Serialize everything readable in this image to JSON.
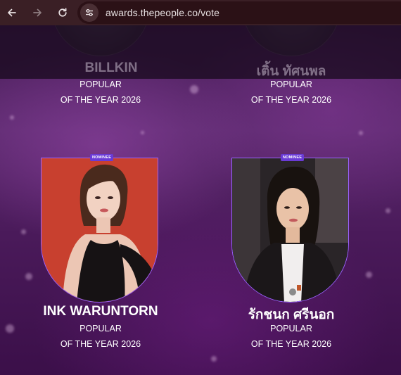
{
  "browser": {
    "url": "awards.thepeople.co/vote",
    "back_icon": "arrow-left-icon",
    "forward_icon": "arrow-right-icon",
    "reload_icon": "reload-icon",
    "site_info_icon": "tune-icon"
  },
  "previous_row": [
    {
      "name": "BILLKIN",
      "caption_line1": "POPULAR",
      "caption_line2": "OF THE YEAR 2026"
    },
    {
      "name": "เติ้น ทัศนพล",
      "caption_line1": "POPULAR",
      "caption_line2": "OF THE YEAR 2026"
    }
  ],
  "nominees": [
    {
      "badge": "NOMINEE",
      "name": "INK WARUNTORN",
      "caption_line1": "POPULAR",
      "caption_line2": "OF THE YEAR 2026"
    },
    {
      "badge": "NOMINEE",
      "name": "รักชนก ศรีนอก",
      "caption_line1": "POPULAR",
      "caption_line2": "OF THE YEAR 2026"
    }
  ],
  "colors": {
    "card_border": "#9a62ff",
    "badge_bg": "#6a3bd6",
    "card1_photo_bg": "#c8402f",
    "card2_photo_bg": "#2a2528"
  }
}
